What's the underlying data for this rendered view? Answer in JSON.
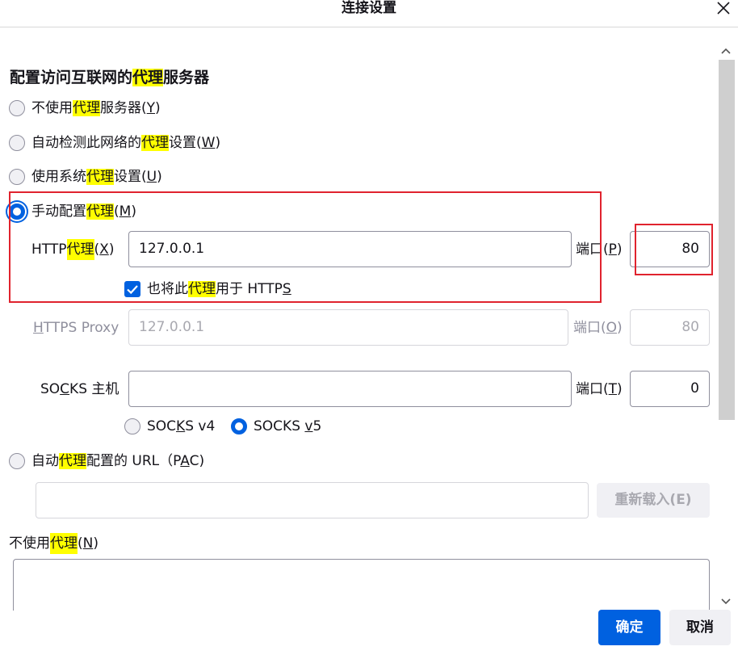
{
  "window": {
    "title": "连接设置"
  },
  "heading": {
    "pre": "配置访问互联网的",
    "hl": "代理",
    "post": "服务器"
  },
  "options": {
    "no_proxy": {
      "pre": "不使用",
      "hl": "代理",
      "mid": "服务器(",
      "key": "Y",
      "post": ")"
    },
    "auto_detect": {
      "pre": "自动检测此网络的",
      "hl": "代理",
      "mid": "设置(",
      "key": "W",
      "post": ")"
    },
    "system": {
      "pre": "使用系统",
      "hl": "代理",
      "mid": "设置(",
      "key": "U",
      "post": ")"
    },
    "manual": {
      "pre": "手动配置",
      "hl": "代理",
      "mid": "(",
      "key": "M",
      "post": ")"
    },
    "pac": {
      "pre": "自动",
      "hl": "代理",
      "mid": "配置的 URL（P",
      "key": "A",
      "post": "C)"
    }
  },
  "http": {
    "label_pre": "HTTP ",
    "label_hl": "代理",
    "label_mid": "(",
    "label_key": "X",
    "label_post": ")",
    "value": "127.0.0.1",
    "port_pre": "端口(",
    "port_key": "P",
    "port_post": ")",
    "port_value": "80"
  },
  "also_https": {
    "pre": "也将此",
    "hl": "代理",
    "mid": "用于 HTTP",
    "key": "S"
  },
  "https": {
    "label_key": "H",
    "label_post": "TTPS Proxy",
    "value": "127.0.0.1",
    "port_pre": "端口(",
    "port_key": "O",
    "port_post": ")",
    "port_value": "80"
  },
  "socks": {
    "label_pre": "SO",
    "label_key": "C",
    "label_post": "KS 主机",
    "value": "",
    "port_pre": "端口(",
    "port_key": "T",
    "port_post": ")",
    "port_value": "0",
    "v4_pre": "SOC",
    "v4_key": "K",
    "v4_post": "S v4",
    "v5_pre": "SOCKS ",
    "v5_key": "v",
    "v5_post": "5"
  },
  "pac_reload": "重新载入(E)",
  "no_proxy_for": {
    "pre": "不使用",
    "hl": "代理",
    "mid": "(",
    "key": "N",
    "post": ")"
  },
  "buttons": {
    "ok": "确定",
    "cancel": "取消"
  },
  "colors": {
    "accent": "#0061e0",
    "highlight": "#ffff00",
    "annotation": "#e0232e"
  }
}
